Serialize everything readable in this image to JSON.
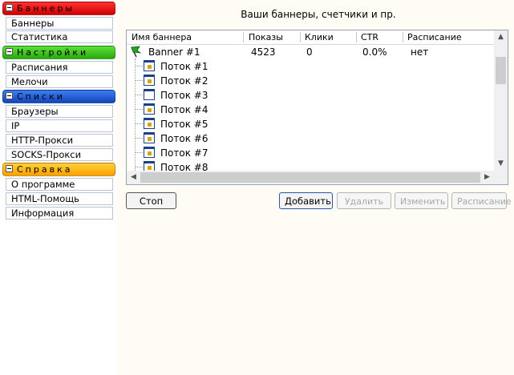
{
  "sidebar": {
    "sections": [
      {
        "title": "Баннеры",
        "color": "#e01010",
        "items": [
          "Баннеры",
          "Статистика"
        ]
      },
      {
        "title": "Настройки",
        "color": "#37c21a",
        "items": [
          "Расписания",
          "Мелочи"
        ]
      },
      {
        "title": "Списки",
        "color": "#1f5fd8",
        "items": [
          "Браузеры",
          "IP",
          "HTTP-Прокси",
          "SOCKS-Прокси"
        ]
      },
      {
        "title": "Справка",
        "color": "#ffb400",
        "items": [
          "О программе",
          "HTML-Помощь",
          "Информация"
        ]
      }
    ]
  },
  "main": {
    "title": "Ваши баннеры, счетчики и пр.",
    "columns": [
      "Имя баннера",
      "Показы",
      "Клики",
      "CTR",
      "Расписание"
    ],
    "banner": {
      "name": "Banner #1",
      "shows": "4523",
      "clicks": "0",
      "ctr": "0.0%",
      "schedule": "нет"
    },
    "flows": [
      "Поток #1",
      "Поток #2",
      "Поток #3",
      "Поток #4",
      "Поток #5",
      "Поток #6",
      "Поток #7",
      "Поток #8"
    ]
  },
  "buttons": {
    "stop": "Стоп",
    "add": "Добавить",
    "delete": "Удалить",
    "edit": "Изменить",
    "schedule": "Расписание"
  },
  "icons": {
    "banner": "green-flag-icon",
    "flow": "window-icon"
  }
}
